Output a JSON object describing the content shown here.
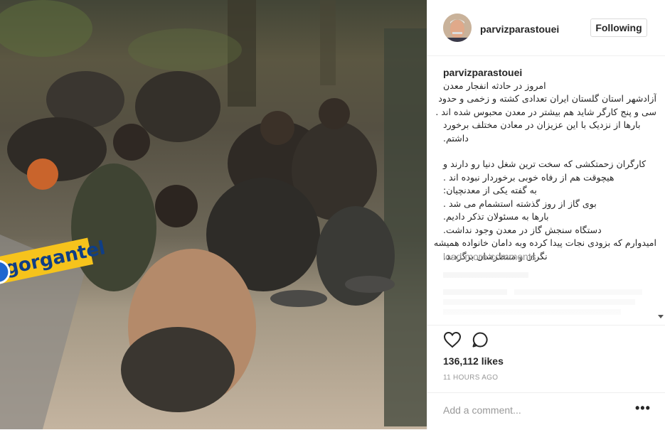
{
  "post": {
    "username": "parvizparastouei",
    "follow_label": "Following",
    "photo_watermark": "gorgantel",
    "caption_user": "parvizparastouei",
    "caption_lines_1": [
      "امروز در حادثه انفجار معدن",
      "آزادشهر استان گلستان ایران تعدادی کشته و زخمی و حدود",
      "سی و پنج کارگر شاید هم بیشتر در معدن محبوس شده اند .",
      "بارها از نزدیک با این عزیزان در معادن مختلف برخورد",
      "داشتم."
    ],
    "caption_lines_2": [
      "کارگران زحمتکشی که سخت ترین شغل دنیا رو دارند و",
      "هیچوقت هم از رفاه خوبی برخوردار نبوده اند .",
      "به گفته یکی از معدنچیان:",
      "بوی گاز از روز گذشته استشمام می شد .",
      "بارها به مسئولان تذکر دادیم.",
      "دستگاه سنجش گاز در معدن وجود نداشت.",
      "امیدوارم که بزودی نجات پیدا کرده وبه دامان خانواده همیشه",
      "نگران و منتظرشان برگردند."
    ],
    "load_more": "load more comments",
    "likes": "136,112 likes",
    "time": "11 HOURS AGO",
    "add_comment_placeholder": "Add a comment...",
    "more_label": "•••"
  },
  "icons": {
    "heart": "heart-icon",
    "comment": "comment-icon",
    "more": "more-options-icon"
  },
  "colors": {
    "text": "#262626",
    "muted": "#999999",
    "border": "#efefef",
    "watermark_bg": "#f6c31c",
    "watermark_text": "#0f3e86"
  }
}
